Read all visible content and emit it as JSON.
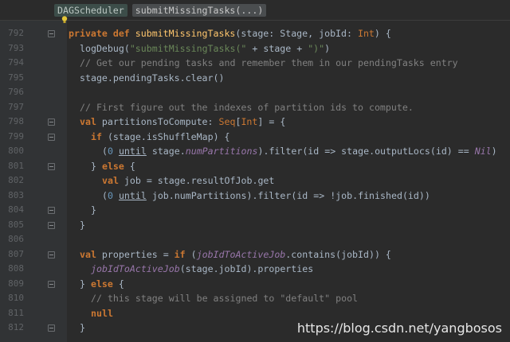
{
  "breadcrumb": [
    "DAGScheduler",
    "submitMissingTasks(...)"
  ],
  "watermark": "https://blog.csdn.net/yangbosos",
  "lines": [
    {
      "n": "792",
      "fold": true,
      "indent": 0,
      "tokens": [
        {
          "t": "private ",
          "c": "kw"
        },
        {
          "t": "def ",
          "c": "kw"
        },
        {
          "t": "submitMissingTasks",
          "c": "fn"
        },
        {
          "t": "(stage: Stage, jobId: ",
          "c": ""
        },
        {
          "t": "Int",
          "c": "ty"
        },
        {
          "t": ") {",
          "c": ""
        }
      ]
    },
    {
      "n": "793",
      "fold": false,
      "indent": 1,
      "tokens": [
        {
          "t": "logDebug(",
          "c": ""
        },
        {
          "t": "\"submitMissingTasks(\"",
          "c": "str"
        },
        {
          "t": " + stage + ",
          "c": ""
        },
        {
          "t": "\")\"",
          "c": "str"
        },
        {
          "t": ")",
          "c": ""
        }
      ]
    },
    {
      "n": "794",
      "fold": false,
      "indent": 1,
      "tokens": [
        {
          "t": "// Get our pending tasks and remember them in our pendingTasks entry",
          "c": "cm"
        }
      ]
    },
    {
      "n": "795",
      "fold": false,
      "indent": 1,
      "tokens": [
        {
          "t": "stage.pendingTasks.clear()",
          "c": ""
        }
      ]
    },
    {
      "n": "796",
      "fold": false,
      "indent": 0,
      "tokens": []
    },
    {
      "n": "797",
      "fold": false,
      "indent": 1,
      "tokens": [
        {
          "t": "// First figure out the indexes of partition ids to compute.",
          "c": "cm"
        }
      ]
    },
    {
      "n": "798",
      "fold": true,
      "indent": 1,
      "tokens": [
        {
          "t": "val ",
          "c": "kw"
        },
        {
          "t": "partitionsToCompute: ",
          "c": ""
        },
        {
          "t": "Seq",
          "c": "ty"
        },
        {
          "t": "[",
          "c": ""
        },
        {
          "t": "Int",
          "c": "ty"
        },
        {
          "t": "] = {",
          "c": ""
        }
      ]
    },
    {
      "n": "799",
      "fold": true,
      "indent": 2,
      "tokens": [
        {
          "t": "if ",
          "c": "kw"
        },
        {
          "t": "(stage.isShuffleMap) {",
          "c": ""
        }
      ]
    },
    {
      "n": "800",
      "fold": false,
      "indent": 3,
      "tokens": [
        {
          "t": "(",
          "c": ""
        },
        {
          "t": "0",
          "c": "num"
        },
        {
          "t": " ",
          "c": ""
        },
        {
          "t": "until",
          "c": "ul"
        },
        {
          "t": " stage.",
          "c": ""
        },
        {
          "t": "numPartitions",
          "c": "it"
        },
        {
          "t": ").filter(id => stage.outputLocs(id) == ",
          "c": ""
        },
        {
          "t": "Nil",
          "c": "it"
        },
        {
          "t": ")",
          "c": ""
        }
      ]
    },
    {
      "n": "801",
      "fold": true,
      "indent": 2,
      "tokens": [
        {
          "t": "} ",
          "c": ""
        },
        {
          "t": "else",
          "c": "kw"
        },
        {
          "t": " {",
          "c": ""
        }
      ]
    },
    {
      "n": "802",
      "fold": false,
      "indent": 3,
      "tokens": [
        {
          "t": "val ",
          "c": "kw"
        },
        {
          "t": "job = stage.resultOfJob.get",
          "c": ""
        }
      ]
    },
    {
      "n": "803",
      "fold": false,
      "indent": 3,
      "tokens": [
        {
          "t": "(",
          "c": ""
        },
        {
          "t": "0",
          "c": "num"
        },
        {
          "t": " ",
          "c": ""
        },
        {
          "t": "until",
          "c": "ul"
        },
        {
          "t": " job.numPartitions).filter(id => !job.finished(id))",
          "c": ""
        }
      ]
    },
    {
      "n": "804",
      "fold": true,
      "indent": 2,
      "tokens": [
        {
          "t": "}",
          "c": ""
        }
      ]
    },
    {
      "n": "805",
      "fold": true,
      "indent": 1,
      "tokens": [
        {
          "t": "}",
          "c": ""
        }
      ]
    },
    {
      "n": "806",
      "fold": false,
      "indent": 0,
      "tokens": []
    },
    {
      "n": "807",
      "fold": true,
      "indent": 1,
      "tokens": [
        {
          "t": "val ",
          "c": "kw"
        },
        {
          "t": "properties = ",
          "c": ""
        },
        {
          "t": "if ",
          "c": "kw"
        },
        {
          "t": "(",
          "c": ""
        },
        {
          "t": "jobIdToActiveJob",
          "c": "it"
        },
        {
          "t": ".contains(jobId)) {",
          "c": ""
        }
      ]
    },
    {
      "n": "808",
      "fold": false,
      "indent": 2,
      "tokens": [
        {
          "t": "jobIdToActiveJob",
          "c": "it"
        },
        {
          "t": "(stage.jobId).properties",
          "c": ""
        }
      ]
    },
    {
      "n": "809",
      "fold": true,
      "indent": 1,
      "tokens": [
        {
          "t": "} ",
          "c": ""
        },
        {
          "t": "else",
          "c": "kw"
        },
        {
          "t": " {",
          "c": ""
        }
      ]
    },
    {
      "n": "810",
      "fold": false,
      "indent": 2,
      "tokens": [
        {
          "t": "// this stage will be assigned to \"default\" pool",
          "c": "cm"
        }
      ]
    },
    {
      "n": "811",
      "fold": false,
      "indent": 2,
      "tokens": [
        {
          "t": "null",
          "c": "kw"
        }
      ]
    },
    {
      "n": "812",
      "fold": true,
      "indent": 1,
      "tokens": [
        {
          "t": "}",
          "c": ""
        }
      ]
    }
  ]
}
